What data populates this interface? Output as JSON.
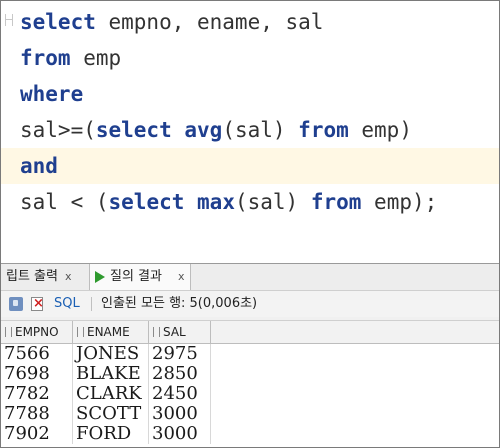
{
  "editor": {
    "lines": [
      [
        {
          "t": "select",
          "s": "kw"
        },
        {
          "t": " empno, ename, sal",
          "s": ""
        }
      ],
      [
        {
          "t": "from",
          "s": "kw"
        },
        {
          "t": " emp",
          "s": ""
        }
      ],
      [
        {
          "t": "where",
          "s": "kw"
        }
      ],
      [
        {
          "t": "sal>=(",
          "s": ""
        },
        {
          "t": "select",
          "s": "kw"
        },
        {
          "t": " ",
          "s": ""
        },
        {
          "t": "avg",
          "s": "fn"
        },
        {
          "t": "(sal) ",
          "s": ""
        },
        {
          "t": "from",
          "s": "kw"
        },
        {
          "t": " emp)",
          "s": ""
        }
      ],
      [
        {
          "t": "and",
          "s": "kw"
        }
      ],
      [
        {
          "t": "sal < (",
          "s": ""
        },
        {
          "t": "select",
          "s": "kw"
        },
        {
          "t": " ",
          "s": ""
        },
        {
          "t": "max",
          "s": "fn"
        },
        {
          "t": "(sal) ",
          "s": ""
        },
        {
          "t": "from",
          "s": "kw"
        },
        {
          "t": " emp);",
          "s": ""
        }
      ]
    ],
    "current_line": 4
  },
  "tabs": {
    "output_label": "립트 출력",
    "output_close": "x",
    "results_label": "질의 결과",
    "results_close": "x"
  },
  "toolbar": {
    "sql_label": "SQL",
    "status": "인출된 모든 행: 5(0,006초)"
  },
  "results": {
    "columns": [
      "EMPNO",
      "ENAME",
      "SAL"
    ],
    "rows": [
      [
        "7566",
        "JONES",
        "2975"
      ],
      [
        "7698",
        "BLAKE",
        "2850"
      ],
      [
        "7782",
        "CLARK",
        "2450"
      ],
      [
        "7788",
        "SCOTT",
        "3000"
      ],
      [
        "7902",
        "FORD",
        "3000"
      ]
    ]
  },
  "colors": {
    "keyword": "#1f3f8f",
    "current_line_bg": "#fff8e4",
    "run_icon": "#2e9a2e",
    "link": "#1a5fb4"
  }
}
